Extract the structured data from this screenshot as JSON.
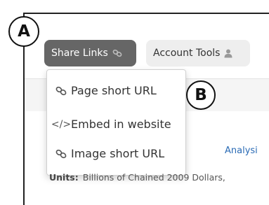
{
  "annotations": {
    "a": "A",
    "b": "B"
  },
  "toolbar": {
    "share_label": "Share Links",
    "share_icon": "link-icon",
    "account_label": "Account Tools",
    "account_icon": "user-icon"
  },
  "share_menu": {
    "items": [
      {
        "label": "Page short URL",
        "icon": "link-icon"
      },
      {
        "label": "Embed in website",
        "icon": "code-icon",
        "glyph": "</>"
      },
      {
        "label": "Image short URL",
        "icon": "link-icon"
      }
    ]
  },
  "page": {
    "analysis_text": "Analysi",
    "units_label": "Units:",
    "units_value": "Billions of Chained 2009 Dollars,"
  },
  "colors": {
    "share_bg": "#666666",
    "account_bg": "#eeeeee",
    "link": "#2a6bb5"
  }
}
